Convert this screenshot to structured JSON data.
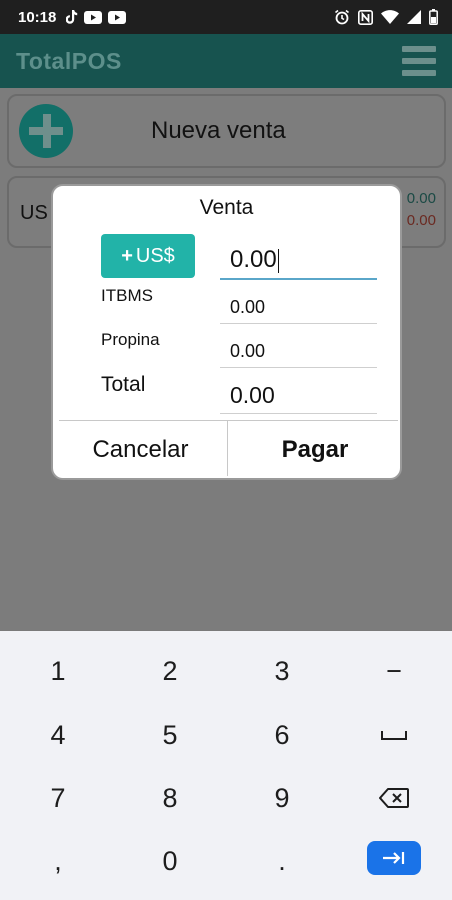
{
  "status_bar": {
    "time": "10:18",
    "left_icons": [
      "tiktok-icon",
      "youtube-icon",
      "youtube-icon"
    ],
    "right_icons": [
      "alarm-icon",
      "nfc-icon",
      "wifi-icon",
      "signal-icon",
      "battery-icon"
    ]
  },
  "app_bar": {
    "title": "TotalPOS",
    "menu_icon": "hamburger-menu-icon"
  },
  "background": {
    "new_sale_label": "Nueva venta",
    "summary_currency": "US",
    "summary_value_1": "0.00",
    "summary_value_2": "0.00"
  },
  "dialog": {
    "title": "Venta",
    "currency_button": "US$",
    "currency_button_prefix": "+",
    "fields": [
      {
        "label": "",
        "value": "0.00",
        "active": true
      },
      {
        "label": "ITBMS",
        "value": "0.00"
      },
      {
        "label": "Propina",
        "value": "0.00"
      },
      {
        "label": "Total",
        "value": "0.00"
      }
    ],
    "cancel_label": "Cancelar",
    "pay_label": "Pagar"
  },
  "keyboard": {
    "rows": [
      [
        "1",
        "2",
        "3",
        "−"
      ],
      [
        "4",
        "5",
        "6",
        "space"
      ],
      [
        "7",
        "8",
        "9",
        "backspace"
      ],
      [
        ",",
        "0",
        ".",
        "enter"
      ]
    ],
    "labels": {
      "k1": "1",
      "k2": "2",
      "k3": "3",
      "minus": "−",
      "k4": "4",
      "k5": "5",
      "k6": "6",
      "k7": "7",
      "k8": "8",
      "k9": "9",
      "comma": ",",
      "k0": "0",
      "period": "."
    },
    "accent": "#1a73e8"
  },
  "colors": {
    "app_bar": "#17534f",
    "currency_button": "#22b3a8",
    "input_focus": "#5aa6c9"
  }
}
